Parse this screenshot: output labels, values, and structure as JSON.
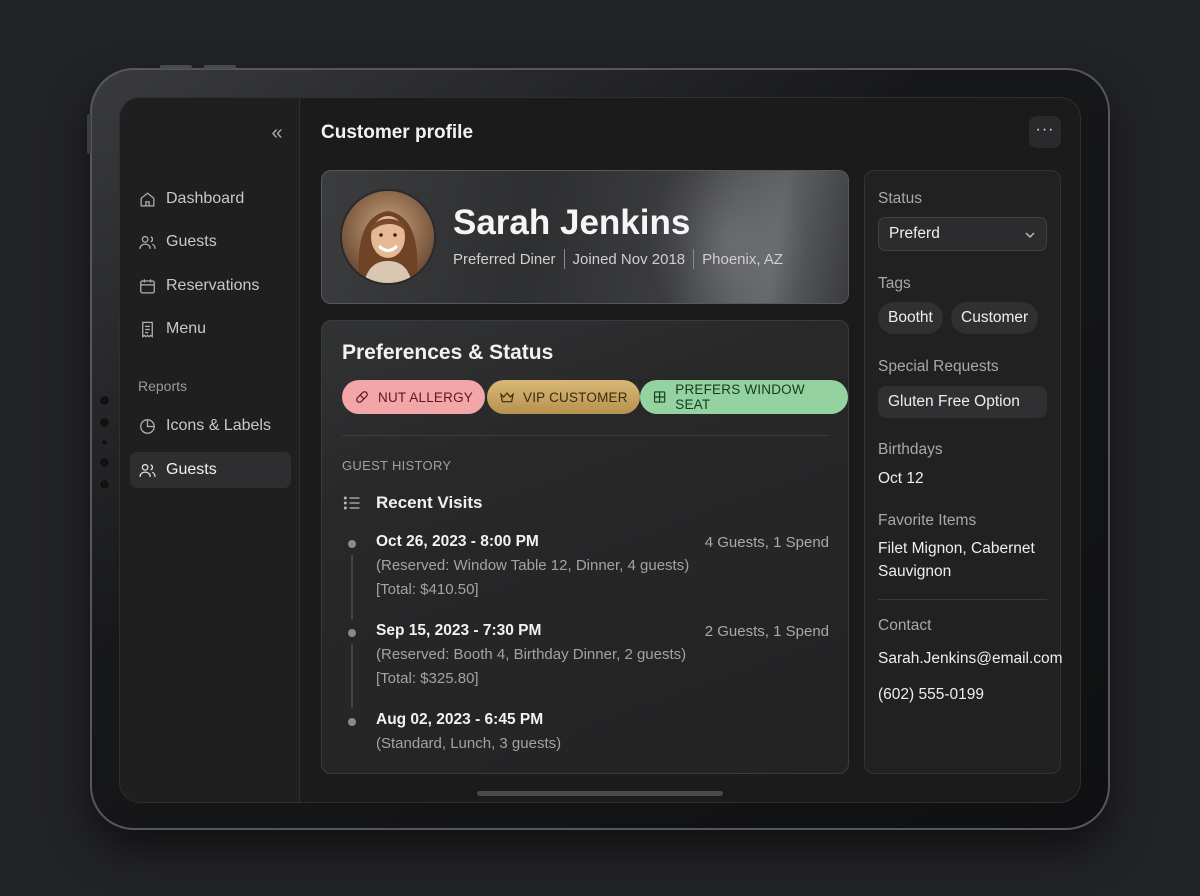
{
  "sidebar": {
    "collapse_icon": "chevrons-left-icon",
    "items": [
      {
        "label": "Dashboard",
        "icon": "home-icon"
      },
      {
        "label": "Guests",
        "icon": "users-icon"
      },
      {
        "label": "Reservations",
        "icon": "calendar-icon"
      },
      {
        "label": "Menu",
        "icon": "receipt-icon"
      }
    ],
    "section_label": "Reports",
    "report_items": [
      {
        "label": "Icons & Labels",
        "icon": "pie-chart-icon"
      },
      {
        "label": "Guests",
        "icon": "users-icon",
        "active": true
      }
    ]
  },
  "header": {
    "title": "Customer profile",
    "more_label": "···"
  },
  "profile": {
    "name": "Sarah Jenkins",
    "tier": "Preferred Diner",
    "joined": "Joined Nov 2018",
    "location": "Phoenix, AZ"
  },
  "preferences": {
    "title": "Preferences & Status",
    "chips": [
      {
        "label": "NUT ALLERGY",
        "icon": "pill-icon",
        "color": "#f2a6a8"
      },
      {
        "label": "VIP CUSTOMER",
        "icon": "crown-icon",
        "color": "#c9a563"
      },
      {
        "label": "PREFERS WINDOW SEAT",
        "icon": "window-icon",
        "color": "#94d3a0"
      }
    ],
    "history_label": "GUEST HISTORY",
    "recent_title": "Recent Visits",
    "visits": [
      {
        "date": "Oct 26, 2023 - 8:00 PM",
        "summary": "4 Guests, 1 Spend",
        "detail1": "(Reserved: Window Table 12, Dinner, 4 guests)",
        "detail2": "[Total: $410.50]"
      },
      {
        "date": "Sep 15, 2023 - 7:30 PM",
        "summary": "2 Guests, 1 Spend",
        "detail1": "(Reserved: Booth 4, Birthday Dinner, 2 guests)",
        "detail2": "[Total: $325.80]"
      },
      {
        "date": "Aug 02, 2023 - 6:45 PM",
        "summary": "",
        "detail1": "(Standard, Lunch, 3 guests)",
        "detail2": ""
      }
    ]
  },
  "side_panel": {
    "status_label": "Status",
    "status_value": "Preferd",
    "tags_label": "Tags",
    "tags": [
      "Bootht",
      "Customer"
    ],
    "requests_label": "Special Requests",
    "request": "Gluten Free Option",
    "birthdays_label": "Birthdays",
    "birthday": "Oct 12",
    "favorites_label": "Favorite Items",
    "favorites": "Filet Mignon, Cabernet Sauvignon",
    "contact_label": "Contact",
    "email": "Sarah.Jenkins@email.com",
    "phone": "(602) 555-0199"
  }
}
